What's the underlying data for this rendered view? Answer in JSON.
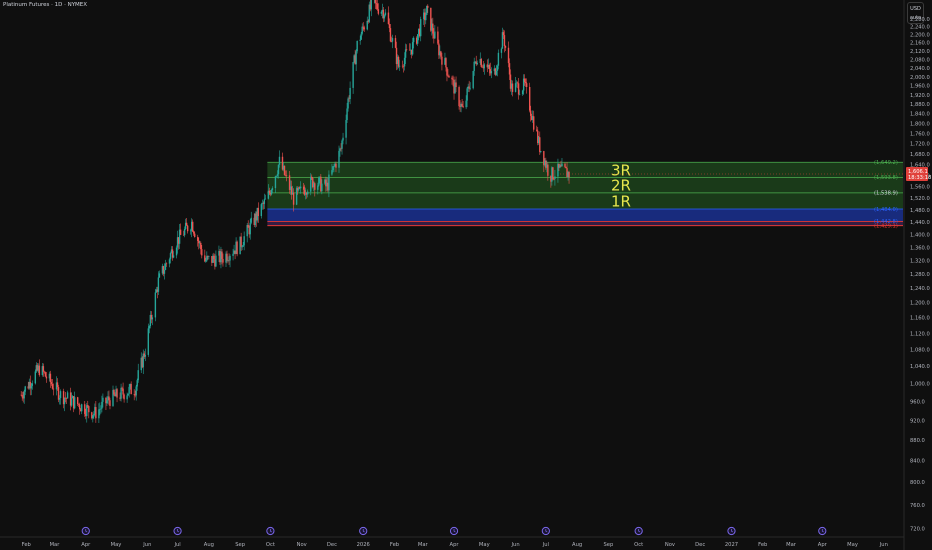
{
  "header": {
    "title": "Platinum Futures · 1D · NYMEX",
    "currency": "USD",
    "scale_mode": "auto"
  },
  "price_badge": {
    "value": "1,606.1",
    "countdown": "18:33:18"
  },
  "colors": {
    "background": "#0f0f0f",
    "up": "#26a69a",
    "down": "#ef5350",
    "zone_green_fill": "#1f4a1d",
    "zone_green_line": "#4caf50",
    "zone_blue_fill": "#1a2f8a",
    "zone_red_line": "#e53935",
    "level_label": "#e6e64d",
    "event_icon": "#7b68ee"
  },
  "chart_data": {
    "type": "candlestick",
    "title": "Platinum Futures · 1D · NYMEX",
    "y_axis": {
      "ticks": [
        720,
        760,
        800,
        840,
        880,
        920,
        960,
        1000,
        1040,
        1080,
        1120,
        1160,
        1200,
        1240,
        1280,
        1320,
        1360,
        1400,
        1440,
        1480,
        1520,
        1560,
        1600,
        1640,
        1680,
        1720,
        1760,
        1800,
        1840,
        1880,
        1920,
        1960,
        2000,
        2040,
        2080,
        2120,
        2160,
        2200,
        2240,
        2280
      ],
      "ylim": [
        707,
        2380
      ],
      "scale": "log"
    },
    "x_axis": {
      "labels": [
        "Feb",
        "Mar",
        "Apr",
        "May",
        "Jun",
        "Jul",
        "Aug",
        "Sep",
        "Oct",
        "Nov",
        "Dec",
        "2026",
        "Feb",
        "Mar",
        "Apr",
        "May",
        "Jun",
        "Jul",
        "Aug",
        "Sep",
        "Oct",
        "Nov",
        "Dec",
        "2027",
        "Feb",
        "Mar",
        "Apr",
        "May",
        "Jun"
      ]
    },
    "price_path": [
      [
        "2025-01-27",
        975
      ],
      [
        "2025-02-14",
        1035
      ],
      [
        "2025-03-07",
        975
      ],
      [
        "2025-04-10",
        935
      ],
      [
        "2025-04-24",
        965
      ],
      [
        "2025-05-20",
        990
      ],
      [
        "2025-05-30",
        1080
      ],
      [
        "2025-06-12",
        1260
      ],
      [
        "2025-06-30",
        1380
      ],
      [
        "2025-07-15",
        1440
      ],
      [
        "2025-07-28",
        1320
      ],
      [
        "2025-08-15",
        1330
      ],
      [
        "2025-09-01",
        1370
      ],
      [
        "2025-09-28",
        1520
      ],
      [
        "2025-10-10",
        1650
      ],
      [
        "2025-10-24",
        1520
      ],
      [
        "2025-11-12",
        1580
      ],
      [
        "2025-11-26",
        1560
      ],
      [
        "2025-12-10",
        1700
      ],
      [
        "2025-12-26",
        2150
      ],
      [
        "2026-01-10",
        2360
      ],
      [
        "2026-01-22",
        2320
      ],
      [
        "2026-02-05",
        2050
      ],
      [
        "2026-02-20",
        2150
      ],
      [
        "2026-03-05",
        2320
      ],
      [
        "2026-03-15",
        2150
      ],
      [
        "2026-03-28",
        2000
      ],
      [
        "2026-04-10",
        1850
      ],
      [
        "2026-04-24",
        2100
      ],
      [
        "2026-05-10",
        2000
      ],
      [
        "2026-05-20",
        2200
      ],
      [
        "2026-05-28",
        1950
      ],
      [
        "2026-06-10",
        1960
      ],
      [
        "2026-06-24",
        1720
      ],
      [
        "2026-07-05",
        1600
      ],
      [
        "2026-07-15",
        1620
      ],
      [
        "2026-07-25",
        1606
      ]
    ],
    "zones": [
      {
        "from": "2025-09-28",
        "top": 1649.2,
        "bottom": 1593.8,
        "color": "green"
      },
      {
        "from": "2025-09-28",
        "top": 1593.8,
        "bottom": 1538.9,
        "color": "green"
      },
      {
        "from": "2025-09-28",
        "top": 1538.9,
        "bottom": 1484.0,
        "color": "green"
      },
      {
        "from": "2025-09-28",
        "top": 1484.0,
        "bottom": 1442.8,
        "color": "blue"
      },
      {
        "from": "2025-09-28",
        "top": 1442.8,
        "bottom": 1429.1,
        "color": "red"
      }
    ],
    "level_labels": [
      {
        "text": "(1,649.2)",
        "value": 1649.2,
        "color": "#4caf50"
      },
      {
        "text": "(1,593.8)",
        "value": 1593.8,
        "color": "#4caf50"
      },
      {
        "text": "(1,538.9)",
        "value": 1538.9,
        "color": "#d1d4dc"
      },
      {
        "text": "(1,484.0)",
        "value": 1484.0,
        "color": "#2962ff"
      },
      {
        "text": "(1,442.8)",
        "value": 1442.8,
        "color": "#2962ff"
      },
      {
        "text": "(1,429.1)",
        "value": 1429.1,
        "color": "#e53935"
      }
    ],
    "zone_tags": [
      {
        "text": "3R",
        "value": 1621
      },
      {
        "text": "2R",
        "value": 1566
      },
      {
        "text": "1R",
        "value": 1511
      }
    ],
    "event_markers": [
      "2025-04-01",
      "2025-07-01",
      "2025-10-01",
      "2026-01-01",
      "2026-04-01",
      "2026-07-01",
      "2026-10-01",
      "2027-01-01",
      "2027-04-01"
    ]
  }
}
